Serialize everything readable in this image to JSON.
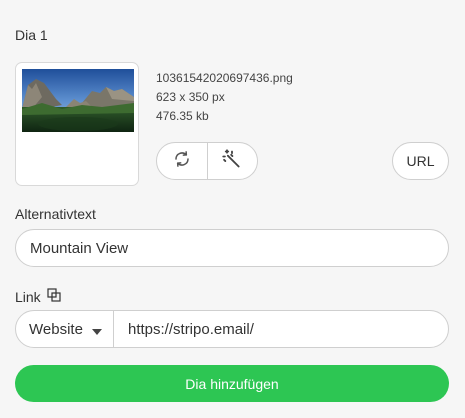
{
  "panel": {
    "title": "Dia 1"
  },
  "image": {
    "file_name": "10361542020697436.png",
    "dimensions": "623 x 350 px",
    "file_size": "476.35 kb"
  },
  "actions": {
    "url_label": "URL"
  },
  "alt_text": {
    "label": "Alternativtext",
    "value": "Mountain View"
  },
  "link": {
    "label": "Link",
    "type_selected": "Website",
    "url_value": "https://stripo.email/"
  },
  "add_button": {
    "label": "Dia hinzufügen"
  },
  "colors": {
    "accent": "#2dc653",
    "background": "#f6f6f6",
    "border": "#cfcfcf"
  },
  "icons": {
    "replace": "refresh-icon",
    "edit": "magic-wand-icon",
    "link_copy": "copy-icon",
    "dropdown": "chevron-down-icon"
  }
}
